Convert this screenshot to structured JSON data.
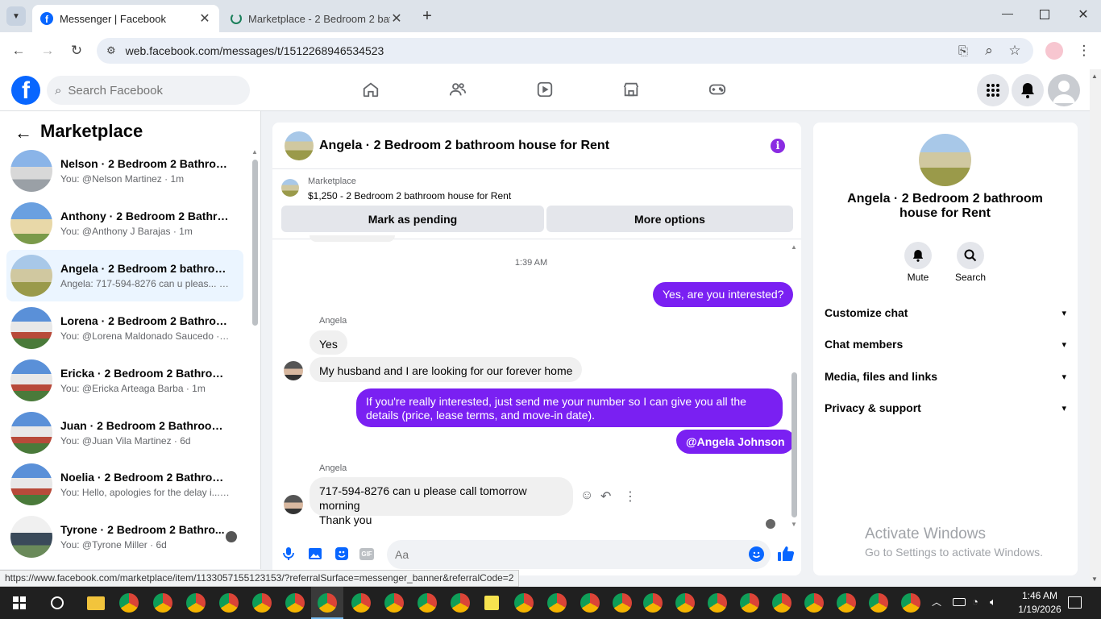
{
  "browser": {
    "tabs": [
      {
        "title": "Messenger | Facebook",
        "active": true
      },
      {
        "title": "Marketplace - 2 Bedroom 2 bat",
        "active": false
      }
    ],
    "url": "web.facebook.com/messages/t/1512268946534523",
    "status_url": "https://www.facebook.com/marketplace/item/1133057155123153/?referralSurface=messenger_banner&referralCode=2"
  },
  "fb": {
    "search_placeholder": "Search Facebook",
    "brand_color": "#0866ff"
  },
  "sidebar": {
    "title": "Marketplace",
    "conversations": [
      {
        "name": "Nelson · 2 Bedroom 2 Bathroom...",
        "preview": "You: @Nelson Martinez · 1m"
      },
      {
        "name": "Anthony · 2 Bedroom 2 Bathroo...",
        "preview": "You: @Anthony J Barajas · 1m"
      },
      {
        "name": "Angela · 2 Bedroom 2 bathroom...",
        "preview": "Angela: 717-594-8276 can u pleas... · 1m"
      },
      {
        "name": "Lorena · 2 Bedroom 2 Bathroom...",
        "preview": "You: @Lorena Maldonado Saucedo · 1m"
      },
      {
        "name": "Ericka · 2 Bedroom 2 Bathroom ...",
        "preview": "You: @Ericka Arteaga Barba · 1m"
      },
      {
        "name": "Juan · 2 Bedroom 2 Bathroom - ...",
        "preview": "You: @Juan Vila Martinez · 6d"
      },
      {
        "name": "Noelia · 2 Bedroom 2 Bathroom...",
        "preview": "You: Hello, apologies for the delay i... · 6d"
      },
      {
        "name": "Tyrone · 2 Bedroom 2 Bathro...",
        "preview": "You: @Tyrone Miller · 6d"
      }
    ]
  },
  "chat": {
    "title": "Angela · 2 Bedroom 2 bathroom house for Rent",
    "listing_label": "Marketplace",
    "listing_text": "$1,250 - 2 Bedroom 2 bathroom house for Rent",
    "mark_pending": "Mark as pending",
    "more_options": "More options",
    "timestamp": "1:39 AM",
    "msg_out_1": "Yes, are you interested?",
    "sender_1": "Angela",
    "msg_in_1": "Yes",
    "msg_in_2": "My husband and I are looking for our forever home",
    "msg_out_2": "If you're really interested, just send me your  number so I can give you all the details (price, lease terms, and move-in date).",
    "msg_out_3": "@Angela Johnson",
    "sender_2": "Angela",
    "msg_in_3_line1": "717-594-8276 can u please call tomorrow morning",
    "msg_in_3_line2": "Thank you",
    "composer_placeholder": "Aa",
    "accent_color": "#7a20f2"
  },
  "rpanel": {
    "title": "Angela · 2 Bedroom 2 bathroom house for Rent",
    "mute": "Mute",
    "search": "Search",
    "sections": [
      "Customize chat",
      "Chat members",
      "Media, files and links",
      "Privacy & support"
    ]
  },
  "watermark": {
    "line1": "Activate Windows",
    "line2": "Go to Settings to activate Windows."
  },
  "taskbar": {
    "time": "1:46 AM",
    "date": "1/19/2026"
  }
}
